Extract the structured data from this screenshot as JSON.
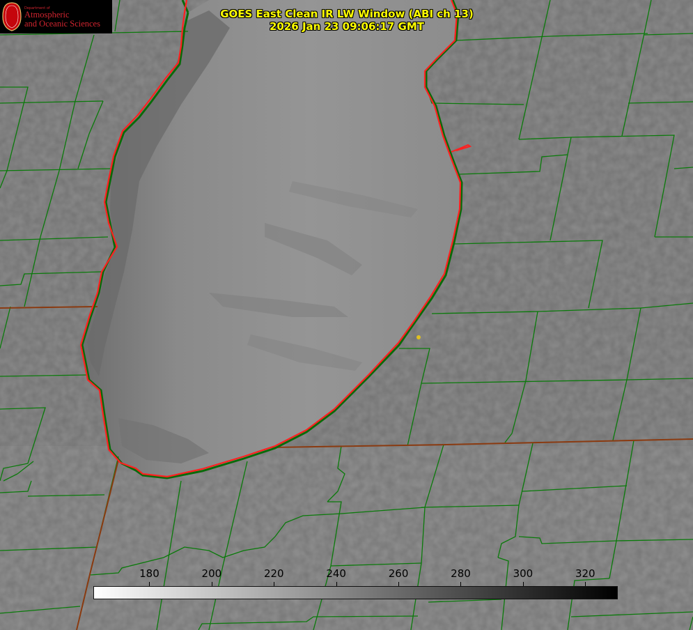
{
  "header": {
    "title": "GOES East Clean IR LW Window (ABI ch 13)",
    "timestamp": "2026 Jan 23 09:06:17 GMT"
  },
  "logo": {
    "department": "Department of",
    "name_line1": "Atmospheric",
    "name_line2": "and Oceanic Sciences",
    "seal_letter": "W",
    "color": "#c5050c"
  },
  "colorbar": {
    "labels": [
      "180",
      "200",
      "220",
      "240",
      "260",
      "280",
      "300",
      "320"
    ],
    "min": 162,
    "max": 330,
    "gradient": [
      "#ffffff",
      "#000000"
    ]
  },
  "map": {
    "lake_outline_color": "#ff2020",
    "boundary_color": "#0a7a0a",
    "state_line_color": "#8a3a10",
    "marker_color": "#e0c020"
  }
}
